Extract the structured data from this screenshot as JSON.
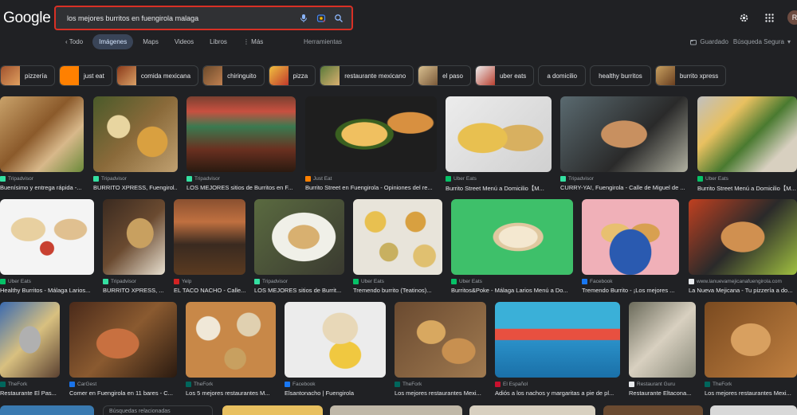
{
  "header": {
    "logo": "Google",
    "query": "los mejores burritos en fuengirola malaga",
    "avatar_letter": "R"
  },
  "tabs": {
    "back_label": "Todo",
    "items": [
      "Imágenes",
      "Maps",
      "Videos",
      "Libros",
      "Más"
    ],
    "tools": "Herramientas",
    "saved": "Guardado",
    "safe_search": "Búsqueda Segura"
  },
  "chips": [
    "pizzería",
    "just eat",
    "comida mexicana",
    "chiringuito",
    "pizza",
    "restaurante mexicano",
    "el paso",
    "uber eats",
    "a domicilio",
    "healthy burritos",
    "burrito xpress"
  ],
  "results": {
    "row1": [
      {
        "source": "Tripadvisor",
        "title": "Buenísimo y entrega rápida -..."
      },
      {
        "source": "Tripadvisor",
        "title": "BURRITO XPRESS, Fuengirol..."
      },
      {
        "source": "Tripadvisor",
        "title": "LOS MEJORES sitios de Burritos en F..."
      },
      {
        "source": "Just Eat",
        "title": "Burrito Street en Fuengirola - Opiniones del re..."
      },
      {
        "source": "Uber Eats",
        "title": "Burrito Street Menú a Domicilio【M..."
      },
      {
        "source": "Tripadvisor",
        "title": "CURRY-YA!, Fuengirola - Calle de Miguel de ..."
      },
      {
        "source": "Uber Eats",
        "title": "Burrito Street Menú a Domicilio【M..."
      }
    ],
    "row2": [
      {
        "source": "Uber Eats",
        "title": "Healthy Burritos - Málaga Larios..."
      },
      {
        "source": "Tripadvisor",
        "title": "BURRITO XPRESS, ..."
      },
      {
        "source": "Yelp",
        "title": "EL TACO NACHO - Calle..."
      },
      {
        "source": "Tripadvisor",
        "title": "LOS MEJORES sitios de Burrit..."
      },
      {
        "source": "Uber Eats",
        "title": "Tremendo burrito (Teatinos)..."
      },
      {
        "source": "Uber Eats",
        "title": "Burritos&Poke - Málaga Larios Menú a Do..."
      },
      {
        "source": "Facebook",
        "title": "Tremendo Burrito - ¡Los mejores ..."
      },
      {
        "source": "www.lanuevamejicanafuengirola.com",
        "title": "La Nueva Mejicana - Tu pizzería a do..."
      }
    ],
    "row3": [
      {
        "source": "TheFork",
        "title": "Restaurante El Pas..."
      },
      {
        "source": "CarGest",
        "title": "Comer en Fuengirola en 11 bares - C..."
      },
      {
        "source": "TheFork",
        "title": "Los 5 mejores restaurantes M..."
      },
      {
        "source": "Facebook",
        "title": "Elsantonacho | Fuengirola"
      },
      {
        "source": "TheFork",
        "title": "Los mejores restaurantes Mexi..."
      },
      {
        "source": "El Español",
        "title": "Adiós a los nachos y margaritas a pie de pl..."
      },
      {
        "source": "Restaurant Guru",
        "title": "Restaurante Eltacona..."
      },
      {
        "source": "TheFork",
        "title": "Los mejores restaurantes Mexi..."
      }
    ],
    "row4_label": "Búsquedas relacionadas"
  }
}
